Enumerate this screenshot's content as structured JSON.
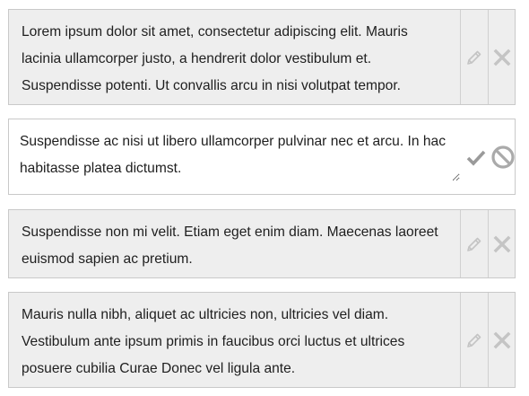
{
  "items": [
    {
      "text": "Lorem ipsum dolor sit amet, consectetur adipiscing elit. Mauris lacinia ullamcorper justo, a hendrerit dolor vestibulum et. Suspendisse potenti. Ut convallis arcu in nisi volutpat tempor.",
      "mode": "view",
      "actions": [
        "pencil-icon",
        "x-icon"
      ]
    },
    {
      "text": "Suspendisse ac nisi ut libero ullamcorper pulvinar nec et arcu. In hac habitasse platea dictumst.",
      "mode": "edit",
      "actions": [
        "checkmark-icon",
        "ban-icon"
      ]
    },
    {
      "text": "Suspendisse non mi velit. Etiam eget enim diam. Maecenas laoreet euismod sapien ac pretium.",
      "mode": "view",
      "actions": [
        "pencil-icon",
        "x-icon"
      ]
    },
    {
      "text": "Mauris nulla nibh, aliquet ac ultricies non, ultricies vel diam. Vestibulum ante ipsum primis in faucibus orci luctus et ultrices posuere cubilia Curae Donec vel ligula ante.",
      "mode": "view",
      "actions": [
        "pencil-icon",
        "x-icon"
      ]
    }
  ],
  "colors": {
    "card_background": "#eeeeee",
    "edit_background": "#ffffff",
    "border": "#c9c9c9",
    "text": "#1e1e1e",
    "icon": "#c4c4c4",
    "icon_active": "#9a9a9a"
  }
}
